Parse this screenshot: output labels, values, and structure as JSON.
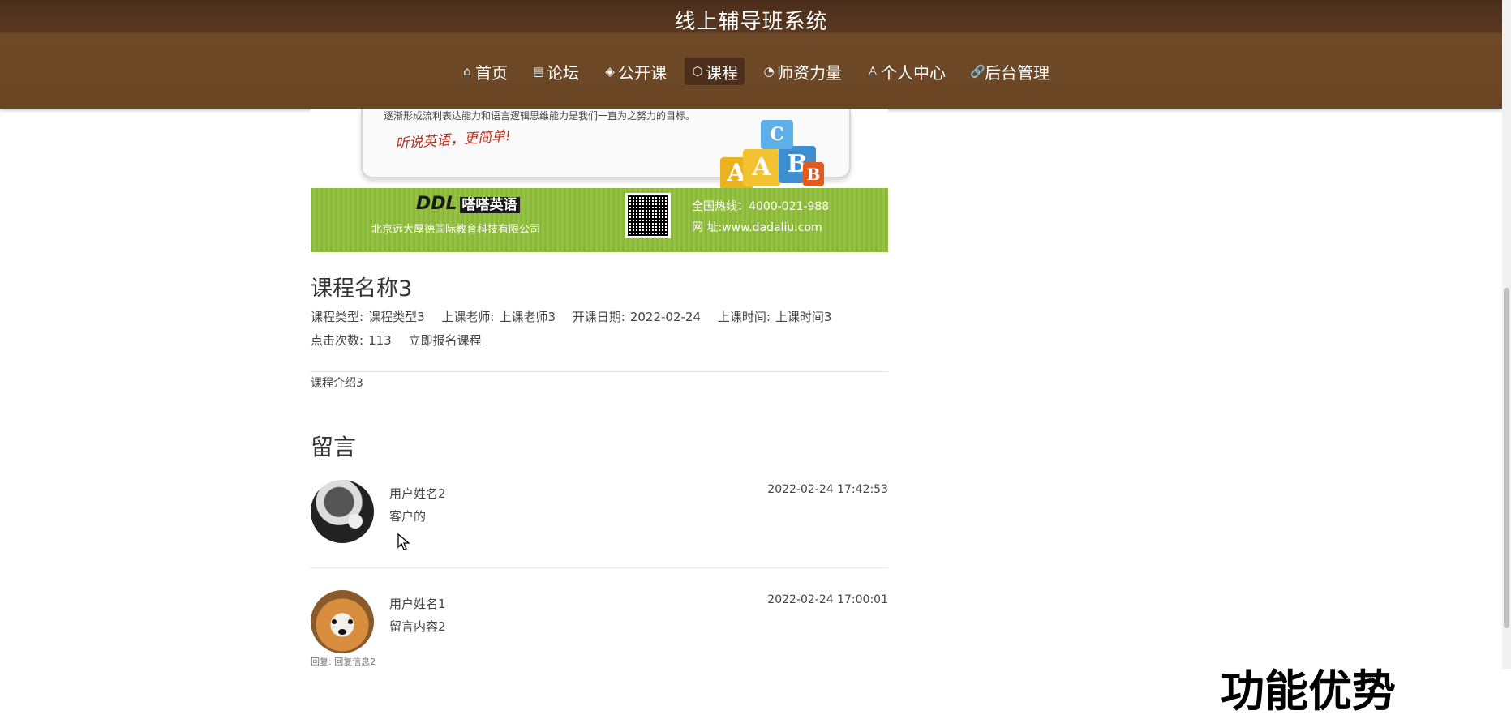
{
  "header": {
    "title": "线上辅导班系统",
    "nav": [
      {
        "icon": "home-icon",
        "glyph": "⌂",
        "label": "首页",
        "active": false
      },
      {
        "icon": "forum-icon",
        "glyph": "▤",
        "label": "论坛",
        "active": false
      },
      {
        "icon": "open-course-icon",
        "glyph": "◈",
        "label": "公开课",
        "active": false
      },
      {
        "icon": "course-icon",
        "glyph": "⬡",
        "label": "课程",
        "active": true
      },
      {
        "icon": "teachers-icon",
        "glyph": "◔",
        "label": "师资力量",
        "active": false
      },
      {
        "icon": "user-icon",
        "glyph": "♙",
        "label": "个人中心",
        "active": false
      },
      {
        "icon": "link-icon",
        "glyph": "🔗",
        "label": "后台管理",
        "active": false
      }
    ]
  },
  "banner": {
    "tagline": "逐渐形成流利表达能力和语言逻辑思维能力是我们一直为之努力的目标。",
    "slogan": "听说英语，更简单!",
    "blocks": [
      "A",
      "A",
      "B",
      "B",
      "C"
    ],
    "logo_text": "DDL",
    "logo_cn": "嗒嗒英语",
    "company": "北京远大厚德国际教育科技有限公司",
    "hotline": "全国热线：4000-021-988",
    "website": "网  址:www.dadaliu.com"
  },
  "course": {
    "title": "课程名称3",
    "type_label": "课程类型:",
    "type_value": "课程类型3",
    "teacher_label": "上课老师:",
    "teacher_value": "上课老师3",
    "start_label": "开课日期:",
    "start_value": "2022-02-24",
    "time_label": "上课时间:",
    "time_value": "上课时间3",
    "clicks_label": "点击次数:",
    "clicks_value": "113",
    "enroll_label": "立即报名课程",
    "intro": "课程介绍3"
  },
  "comments": {
    "title": "留言",
    "items": [
      {
        "name": "用户姓名2",
        "text": "客户的",
        "time": "2022-02-24 17:42:53"
      },
      {
        "name": "用户姓名1",
        "text": "留言内容2",
        "time": "2022-02-24 17:00:01"
      }
    ],
    "reply": "回复: 回复信息2"
  },
  "overlay_text": "功能优势"
}
